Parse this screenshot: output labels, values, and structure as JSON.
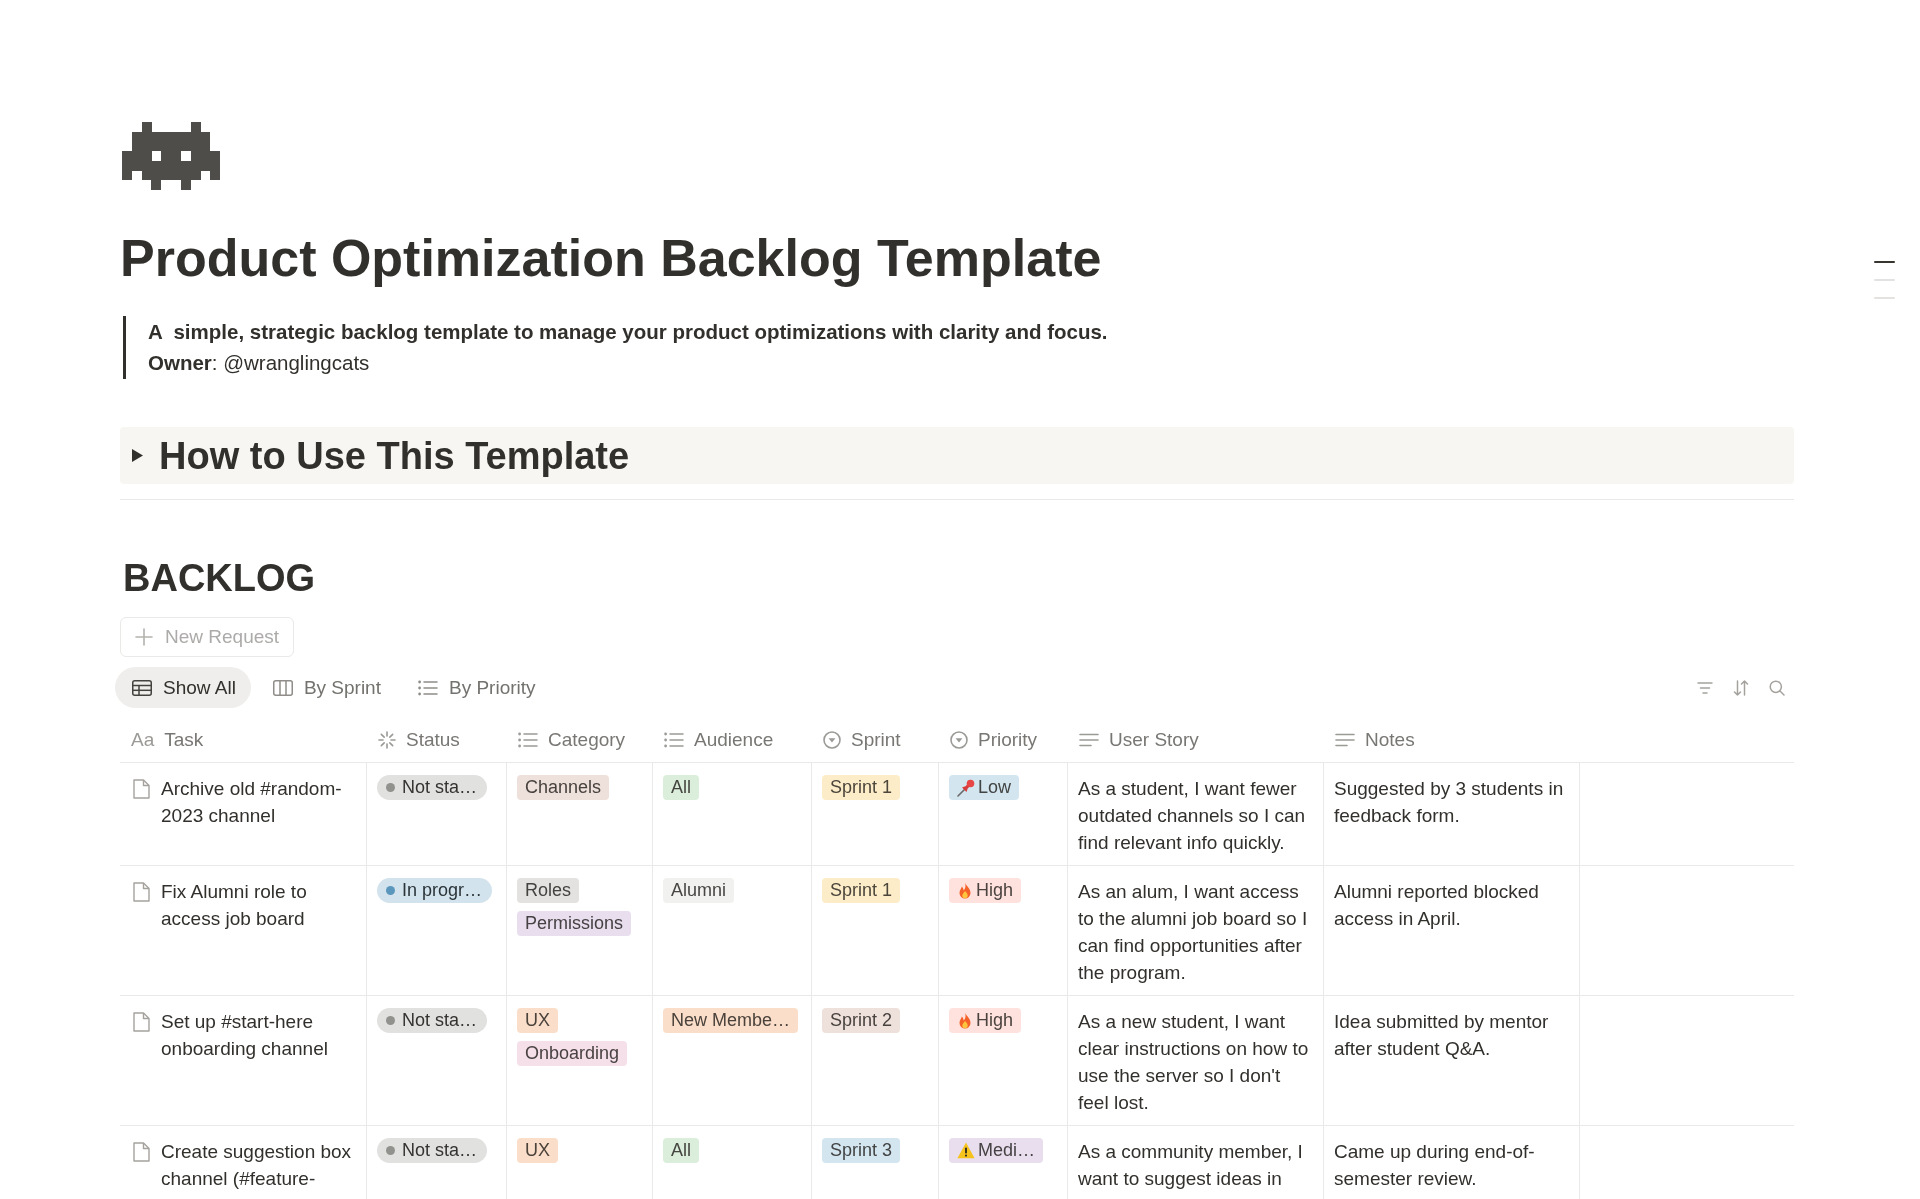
{
  "page": {
    "title": "Product Optimization Backlog Template"
  },
  "quote": {
    "summary": "A  simple, strategic backlog template to manage your product optimizations with clarity and focus.",
    "owner": "**Owner**: @wranglingcats"
  },
  "toggle_heading": {
    "title": "How to Use This Template",
    "expanded": false
  },
  "outline": [
    {
      "selected": true
    },
    {
      "selected": false
    },
    {
      "selected": false
    }
  ],
  "database": {
    "title": "BACKLOG",
    "new_button": "New Request",
    "views": [
      {
        "label": "Show All",
        "kind": "table",
        "selected": true
      },
      {
        "label": "By Sprint",
        "kind": "board",
        "selected": false
      },
      {
        "label": "By Priority",
        "kind": "list",
        "selected": false
      }
    ],
    "table": {
      "columns": [
        {
          "label": "Task",
          "kind": "title",
          "glyph": "Aa"
        },
        {
          "label": "Status",
          "kind": "status"
        },
        {
          "label": "Category",
          "kind": "multi_select"
        },
        {
          "label": "Audience",
          "kind": "multi_select"
        },
        {
          "label": "Sprint",
          "kind": "select"
        },
        {
          "label": "Priority",
          "kind": "select"
        },
        {
          "label": "User Story",
          "kind": "text"
        },
        {
          "label": "Notes",
          "kind": "text"
        }
      ],
      "rows": [
        {
          "task": "Archive old #random-2023 channel",
          "status": {
            "label": "Not sta…",
            "color": "#91918e"
          },
          "category": [
            {
              "label": "Channels",
              "color": "#eee0da"
            }
          ],
          "audience": [
            {
              "label": "All",
              "color": "#dbeddb"
            }
          ],
          "sprint": {
            "label": "Sprint 1",
            "color": "#fdecc8"
          },
          "priority": {
            "label": "Low",
            "kind": "low",
            "color": "#d3e5ef"
          },
          "user_story": "As a student, I want fewer outdated channels so I can find relevant info quickly.",
          "notes": "Suggested by 3 students in feedback form."
        },
        {
          "task": "Fix Alumni role to access job board",
          "status": {
            "label": "In progr…",
            "color": "#5b97bd"
          },
          "category": [
            {
              "label": "Roles",
              "color": "#e3e2e0"
            },
            {
              "label": "Permissions",
              "color": "#e8deee"
            }
          ],
          "audience": [
            {
              "label": "Alumni",
              "color": "#f1f1ef"
            }
          ],
          "sprint": {
            "label": "Sprint 1",
            "color": "#fdecc8"
          },
          "priority": {
            "label": "High",
            "kind": "high",
            "color": "#ffe2dd"
          },
          "user_story": "As an alum, I want access to the alumni job board so I can find opportunities after the program.",
          "notes": "Alumni reported blocked access in April."
        },
        {
          "task": "Set up #start-here onboarding channel",
          "status": {
            "label": "Not sta…",
            "color": "#91918e"
          },
          "category": [
            {
              "label": "UX",
              "color": "#fadec9"
            },
            {
              "label": "Onboarding",
              "color": "#f5e0e9"
            }
          ],
          "audience": [
            {
              "label": "New Membe…",
              "color": "#fadec9"
            }
          ],
          "sprint": {
            "label": "Sprint 2",
            "color": "#eee0da"
          },
          "priority": {
            "label": "High",
            "kind": "high",
            "color": "#ffe2dd"
          },
          "user_story": "As a new student, I want clear instructions on how to use the server so I don't feel lost.",
          "notes": "Idea submitted by mentor after student Q&A."
        },
        {
          "task": "Create suggestion box channel (#feature-",
          "status": {
            "label": "Not sta…",
            "color": "#91918e"
          },
          "category": [
            {
              "label": "UX",
              "color": "#fadec9"
            }
          ],
          "audience": [
            {
              "label": "All",
              "color": "#dbeddb"
            }
          ],
          "sprint": {
            "label": "Sprint 3",
            "color": "#d3e5ef"
          },
          "priority": {
            "label": "Medi…",
            "kind": "medium",
            "color": "#e8deee"
          },
          "user_story": "As a community member, I want to suggest ideas in",
          "notes": "Came up during end-of-semester review."
        }
      ]
    }
  }
}
